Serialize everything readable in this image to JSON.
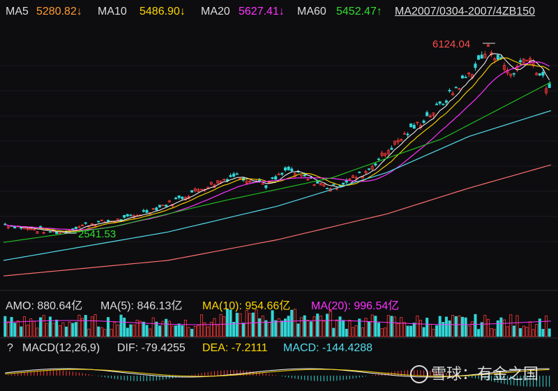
{
  "legend": {
    "ma5_label": "MA5",
    "ma5_value": "5280.82↓",
    "ma10_label": "MA10",
    "ma10_value": "5486.90↓",
    "ma20_label": "MA20",
    "ma20_value": "5627.41↓",
    "ma60_label": "MA60",
    "ma60_value": "5452.47↑",
    "overlap_text": "MA2007/0304-2007/4ZB150"
  },
  "amo": {
    "amo_label": "AMO: 880.64亿",
    "ma5_label": "MA(5): 846.13亿",
    "ma10_label": "MA(10): 954.66亿",
    "ma20_label": "MA(20): 996.54亿"
  },
  "macd": {
    "help": "?",
    "title": "MACD(12,26,9)",
    "dif": "DIF: -79.4255",
    "dea": "DEA: -7.2111",
    "macd": "MACD: -144.4288"
  },
  "watermark": "雪球：有金之国",
  "colors": {
    "up": "#ff3b3b",
    "down": "#33d6d6",
    "ma5": "#ffffff",
    "ma10": "#ffd700",
    "ma20": "#ff33ff",
    "ma60": "#22bb22",
    "ma120": "#55ddee",
    "ma250": "#ff6f6f",
    "ma5_label": "#ff9b33",
    "ma10_label": "#ffd700",
    "ma20_label": "#ff33ff",
    "ma60_label": "#33dd33"
  },
  "chart_data": {
    "type": "candlestick",
    "annotations": [
      {
        "text": "6124.04",
        "type": "high"
      },
      {
        "text": "2541.53",
        "type": "low"
      }
    ],
    "ylim": [
      1500,
      6500
    ],
    "close_path": [
      [
        0,
        2700
      ],
      [
        0.05,
        2600
      ],
      [
        0.1,
        2541.53
      ],
      [
        0.15,
        2700
      ],
      [
        0.22,
        2800
      ],
      [
        0.3,
        3100
      ],
      [
        0.36,
        3400
      ],
      [
        0.42,
        3650
      ],
      [
        0.46,
        3550
      ],
      [
        0.48,
        3450
      ],
      [
        0.52,
        3750
      ],
      [
        0.56,
        3550
      ],
      [
        0.6,
        3400
      ],
      [
        0.66,
        3700
      ],
      [
        0.72,
        4300
      ],
      [
        0.8,
        5000
      ],
      [
        0.86,
        5700
      ],
      [
        0.89,
        6124.04
      ],
      [
        0.93,
        5600
      ],
      [
        0.96,
        6000
      ],
      [
        1.0,
        5280.82
      ]
    ],
    "ma_paths": {
      "ma60": [
        [
          0,
          2350
        ],
        [
          0.2,
          2650
        ],
        [
          0.4,
          3150
        ],
        [
          0.6,
          3600
        ],
        [
          0.8,
          4350
        ],
        [
          1.0,
          5452.47
        ]
      ],
      "ma120": [
        [
          0,
          2000
        ],
        [
          0.3,
          2550
        ],
        [
          0.5,
          3050
        ],
        [
          0.7,
          3700
        ],
        [
          0.85,
          4400
        ],
        [
          1.0,
          4900
        ]
      ],
      "ma250": [
        [
          0,
          1700
        ],
        [
          0.3,
          2000
        ],
        [
          0.5,
          2400
        ],
        [
          0.7,
          2900
        ],
        [
          0.85,
          3400
        ],
        [
          1.0,
          3850
        ]
      ]
    }
  }
}
